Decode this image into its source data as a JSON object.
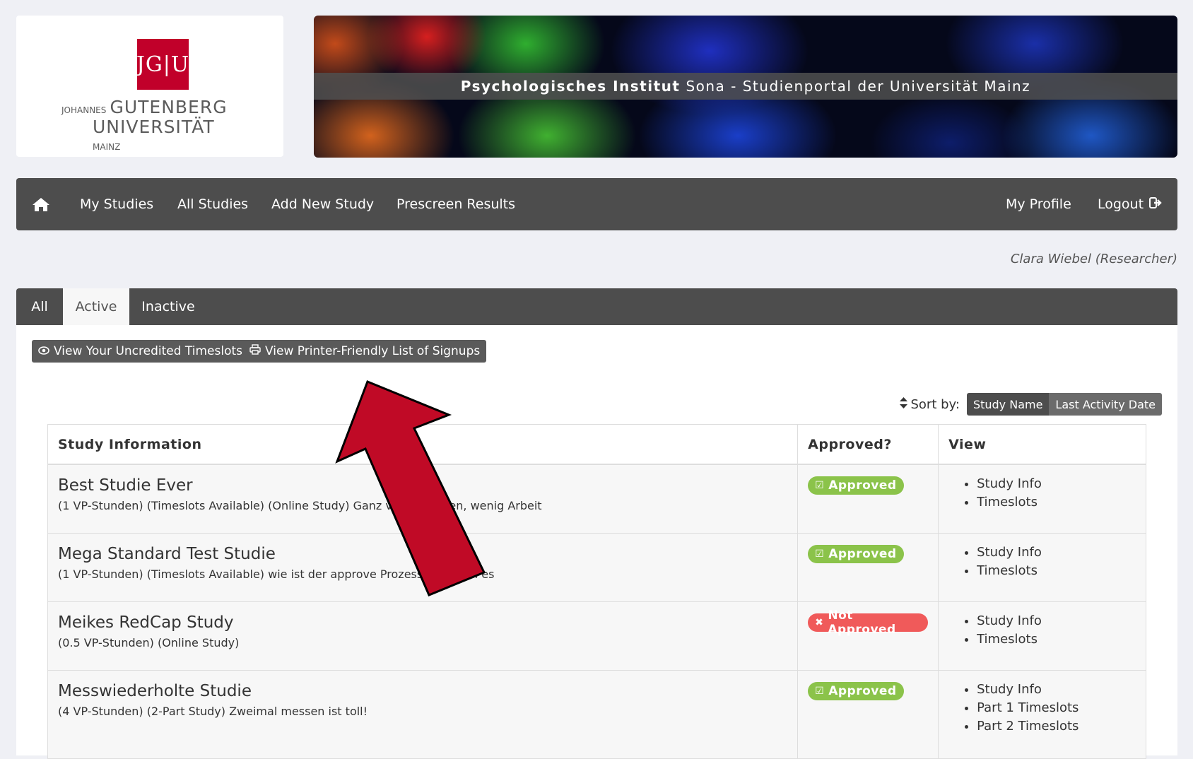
{
  "logo": {
    "mark": "JG|U",
    "line1_small": "JOHANNES",
    "line1_big": "GUTENBERG",
    "line2_big": "UNIVERSITÄT",
    "line2_small": "MAINZ"
  },
  "banner": {
    "title_bold": "Psychologisches Institut",
    "title_rest": "Sona - Studienportal der Universität Mainz"
  },
  "nav": {
    "home_icon": "home-icon",
    "items": [
      "My Studies",
      "All Studies",
      "Add New Study",
      "Prescreen Results"
    ],
    "my_profile": "My Profile",
    "logout": "Logout",
    "logout_icon": "sign-out-icon"
  },
  "user": "Clara Wiebel (Researcher)",
  "tabs": [
    "All",
    "Active",
    "Inactive"
  ],
  "active_tab": "Active",
  "buttons": {
    "uncredited": "View Your Uncredited Timeslots",
    "uncredited_icon": "eye-icon",
    "printer": "View Printer-Friendly List of Signups",
    "printer_icon": "printer-icon"
  },
  "sort": {
    "label": "Sort by:",
    "option1": "Study Name",
    "option2": "Last Activity Date"
  },
  "table": {
    "headers": [
      "Study Information",
      "Approved?",
      "View"
    ],
    "rows": [
      {
        "title": "Best Studie Ever",
        "desc": "(1 VP-Stunden) (Timeslots Available) (Online Study) Ganz viele Stunden, wenig Arbeit",
        "status": "Approved",
        "links": [
          "Study Info",
          "Timeslots"
        ]
      },
      {
        "title": "Mega Standard Test Studie",
        "desc": "(1 VP-Stunden) (Timeslots Available) wie ist der approve Prozess, zeig mal es",
        "status": "Approved",
        "links": [
          "Study Info",
          "Timeslots"
        ]
      },
      {
        "title": "Meikes RedCap Study",
        "desc": "(0.5 VP-Stunden) (Online Study)",
        "status": "Not Approved",
        "links": [
          "Study Info",
          "Timeslots"
        ]
      },
      {
        "title": "Messwiederholte Studie",
        "desc": "(4 VP-Stunden) (2-Part Study) Zweimal messen ist toll!",
        "status": "Approved",
        "links": [
          "Study Info",
          "Part 1 Timeslots",
          "Part 2 Timeslots"
        ]
      }
    ]
  },
  "colors": {
    "approved": "#8bc34a",
    "not_approved": "#f05a5a",
    "arrow": "#c00a26",
    "jgu_red": "#c1002a"
  }
}
